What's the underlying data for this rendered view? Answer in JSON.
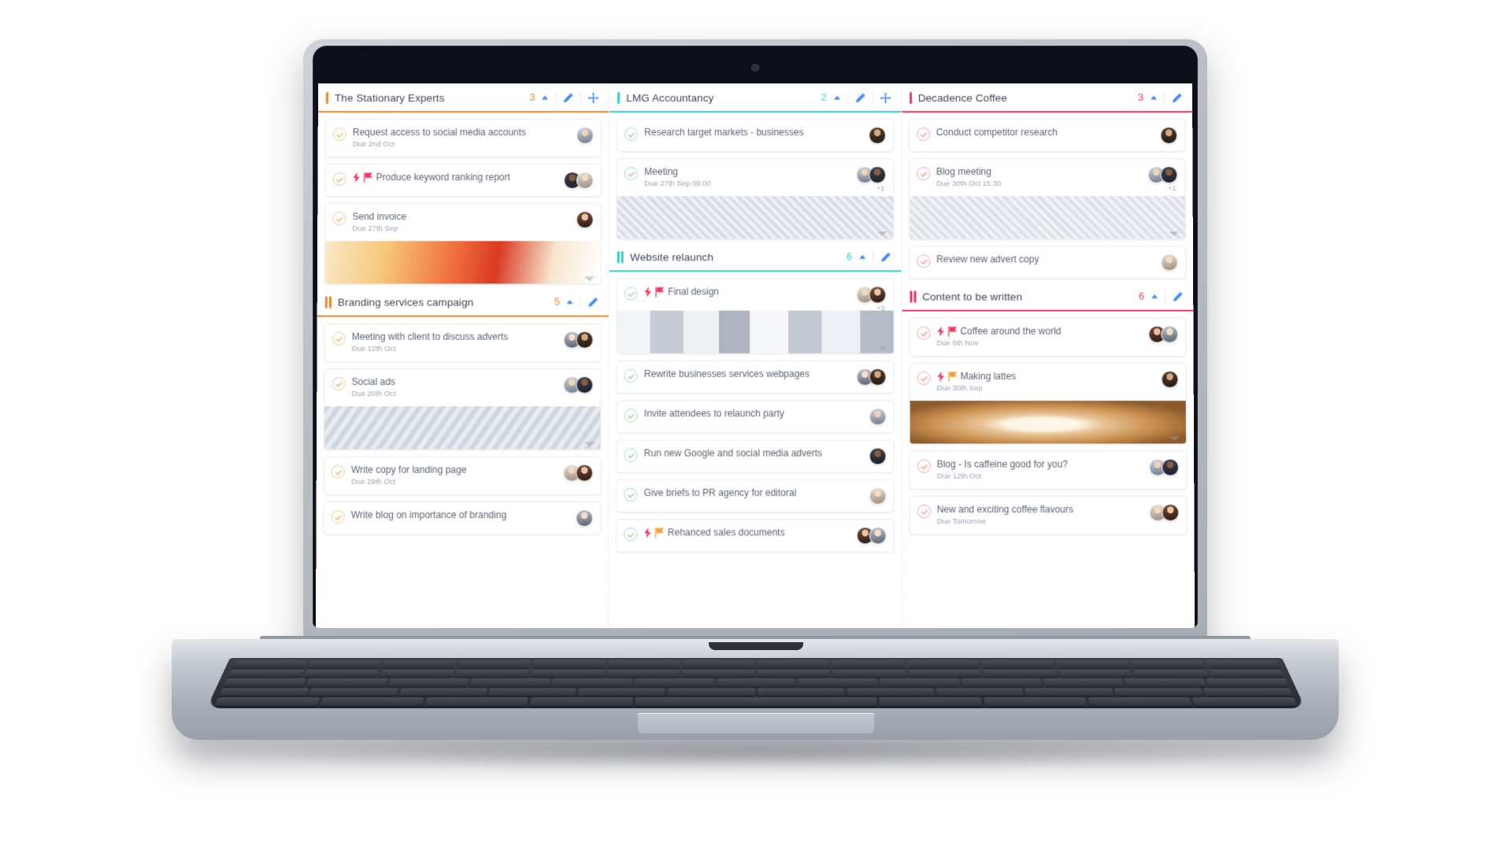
{
  "app": {
    "name": "task-board",
    "colors": {
      "orange": "#f5862a",
      "teal": "#35cfc9",
      "red": "#f6365e",
      "blue": "#3d8bfd",
      "text": "#4a5365",
      "muted": "#9aa3b1"
    }
  },
  "columns": [
    {
      "id": "col-1",
      "groups": [
        {
          "title": "The Stationary Experts",
          "count": "3",
          "accent": "#f5862a",
          "bars": 1,
          "controls": [
            "collapse-chevron",
            "edit-pencil",
            "move-handle"
          ],
          "cards": [
            {
              "title": "Request access to social media accounts",
              "due": "Due 2nd Oct",
              "bolt": false,
              "flag": false,
              "avatars": 1,
              "plus": "",
              "cover": "none"
            },
            {
              "title": "Produce keyword ranking report",
              "due": "",
              "bolt": true,
              "flag": true,
              "avatars": 2,
              "plus": "",
              "cover": "none"
            },
            {
              "title": "Send invoice",
              "due": "Due 27th Sep",
              "bolt": false,
              "flag": false,
              "avatars": 1,
              "plus": "",
              "cover": "print"
            }
          ]
        },
        {
          "title": "Branding services campaign",
          "count": "5",
          "accent": "#f5862a",
          "bars": 2,
          "controls": [
            "collapse-chevron",
            "edit-pencil"
          ],
          "cards": [
            {
              "title": "Meeting with client to discuss adverts",
              "due": "Due 12th Oct",
              "bolt": false,
              "flag": false,
              "avatars": 2,
              "plus": "",
              "cover": "none"
            },
            {
              "title": "Social ads",
              "due": "Due 20th Oct",
              "bolt": false,
              "flag": false,
              "avatars": 2,
              "plus": "",
              "cover": "social"
            },
            {
              "title": "Write copy for landing page",
              "due": "Due 29th Oct",
              "bolt": false,
              "flag": false,
              "avatars": 2,
              "plus": "",
              "cover": "none"
            },
            {
              "title": "Write blog on importance of branding",
              "due": "",
              "bolt": false,
              "flag": false,
              "avatars": 1,
              "plus": "",
              "cover": "none"
            }
          ]
        }
      ]
    },
    {
      "id": "col-2",
      "groups": [
        {
          "title": "LMG Accountancy",
          "count": "2",
          "accent": "#35cfc9",
          "bars": 1,
          "controls": [
            "collapse-chevron",
            "edit-pencil",
            "move-handle"
          ],
          "cards": [
            {
              "title": "Research target markets - businesses",
              "due": "",
              "bolt": false,
              "flag": false,
              "avatars": 1,
              "plus": "",
              "cover": "none"
            },
            {
              "title": "Meeting",
              "due": "Due 27th Sep 09:00",
              "bolt": false,
              "flag": false,
              "avatars": 2,
              "plus": "+1",
              "cover": "meeting"
            }
          ]
        },
        {
          "title": "Website relaunch",
          "count": "6",
          "accent": "#35cfc9",
          "bars": 2,
          "controls": [
            "collapse-chevron",
            "edit-pencil"
          ],
          "cards": [
            {
              "title": "Final design",
              "due": "",
              "bolt": true,
              "flag": true,
              "avatars": 2,
              "plus": "+3",
              "cover": "design"
            },
            {
              "title": "Rewrite businesses services webpages",
              "due": "",
              "bolt": false,
              "flag": false,
              "avatars": 2,
              "plus": "",
              "cover": "none"
            },
            {
              "title": "Invite attendees to relaunch party",
              "due": "",
              "bolt": false,
              "flag": false,
              "avatars": 1,
              "plus": "",
              "cover": "none"
            },
            {
              "title": "Run new Google and social media adverts",
              "due": "",
              "bolt": false,
              "flag": false,
              "avatars": 1,
              "plus": "",
              "cover": "none"
            },
            {
              "title": "Give briefs to PR agency for editoral",
              "due": "",
              "bolt": false,
              "flag": false,
              "avatars": 1,
              "plus": "",
              "cover": "none"
            },
            {
              "title": "Rehanced sales documents",
              "due": "",
              "bolt": true,
              "flag": true,
              "avatars": 2,
              "plus": "",
              "cover": "none"
            }
          ]
        }
      ]
    },
    {
      "id": "col-3",
      "groups": [
        {
          "title": "Decadence Coffee",
          "count": "3",
          "accent": "#f6365e",
          "bars": 1,
          "controls": [
            "collapse-chevron",
            "edit-pencil"
          ],
          "cards": [
            {
              "title": "Conduct competitor research",
              "due": "",
              "bolt": false,
              "flag": false,
              "avatars": 1,
              "plus": "",
              "cover": "none"
            },
            {
              "title": "Blog meeting",
              "due": "Due 30th Oct 15:30",
              "bolt": false,
              "flag": false,
              "avatars": 2,
              "plus": "+1",
              "cover": "blogmeeting"
            },
            {
              "title": "Review new advert copy",
              "due": "",
              "bolt": false,
              "flag": false,
              "avatars": 1,
              "plus": "",
              "cover": "none"
            }
          ]
        },
        {
          "title": "Content to be written",
          "count": "6",
          "accent": "#f6365e",
          "bars": 2,
          "controls": [
            "collapse-chevron",
            "edit-pencil"
          ],
          "cards": [
            {
              "title": "Coffee around the world",
              "due": "Due 5th Nov",
              "bolt": true,
              "flag": true,
              "avatars": 2,
              "plus": "",
              "cover": "none"
            },
            {
              "title": "Making lattes",
              "due": "Due 30th Sep",
              "bolt": true,
              "flag": true,
              "avatars": 1,
              "plus": "",
              "cover": "latte"
            },
            {
              "title": "Blog - Is caffeine good for you?",
              "due": "Due 12th Oct",
              "bolt": false,
              "flag": false,
              "avatars": 2,
              "plus": "",
              "cover": "none"
            },
            {
              "title": "New and exciting coffee flavours",
              "due": "Due Tomorrow",
              "bolt": false,
              "flag": false,
              "avatars": 2,
              "plus": "",
              "cover": "none"
            }
          ]
        }
      ]
    }
  ]
}
